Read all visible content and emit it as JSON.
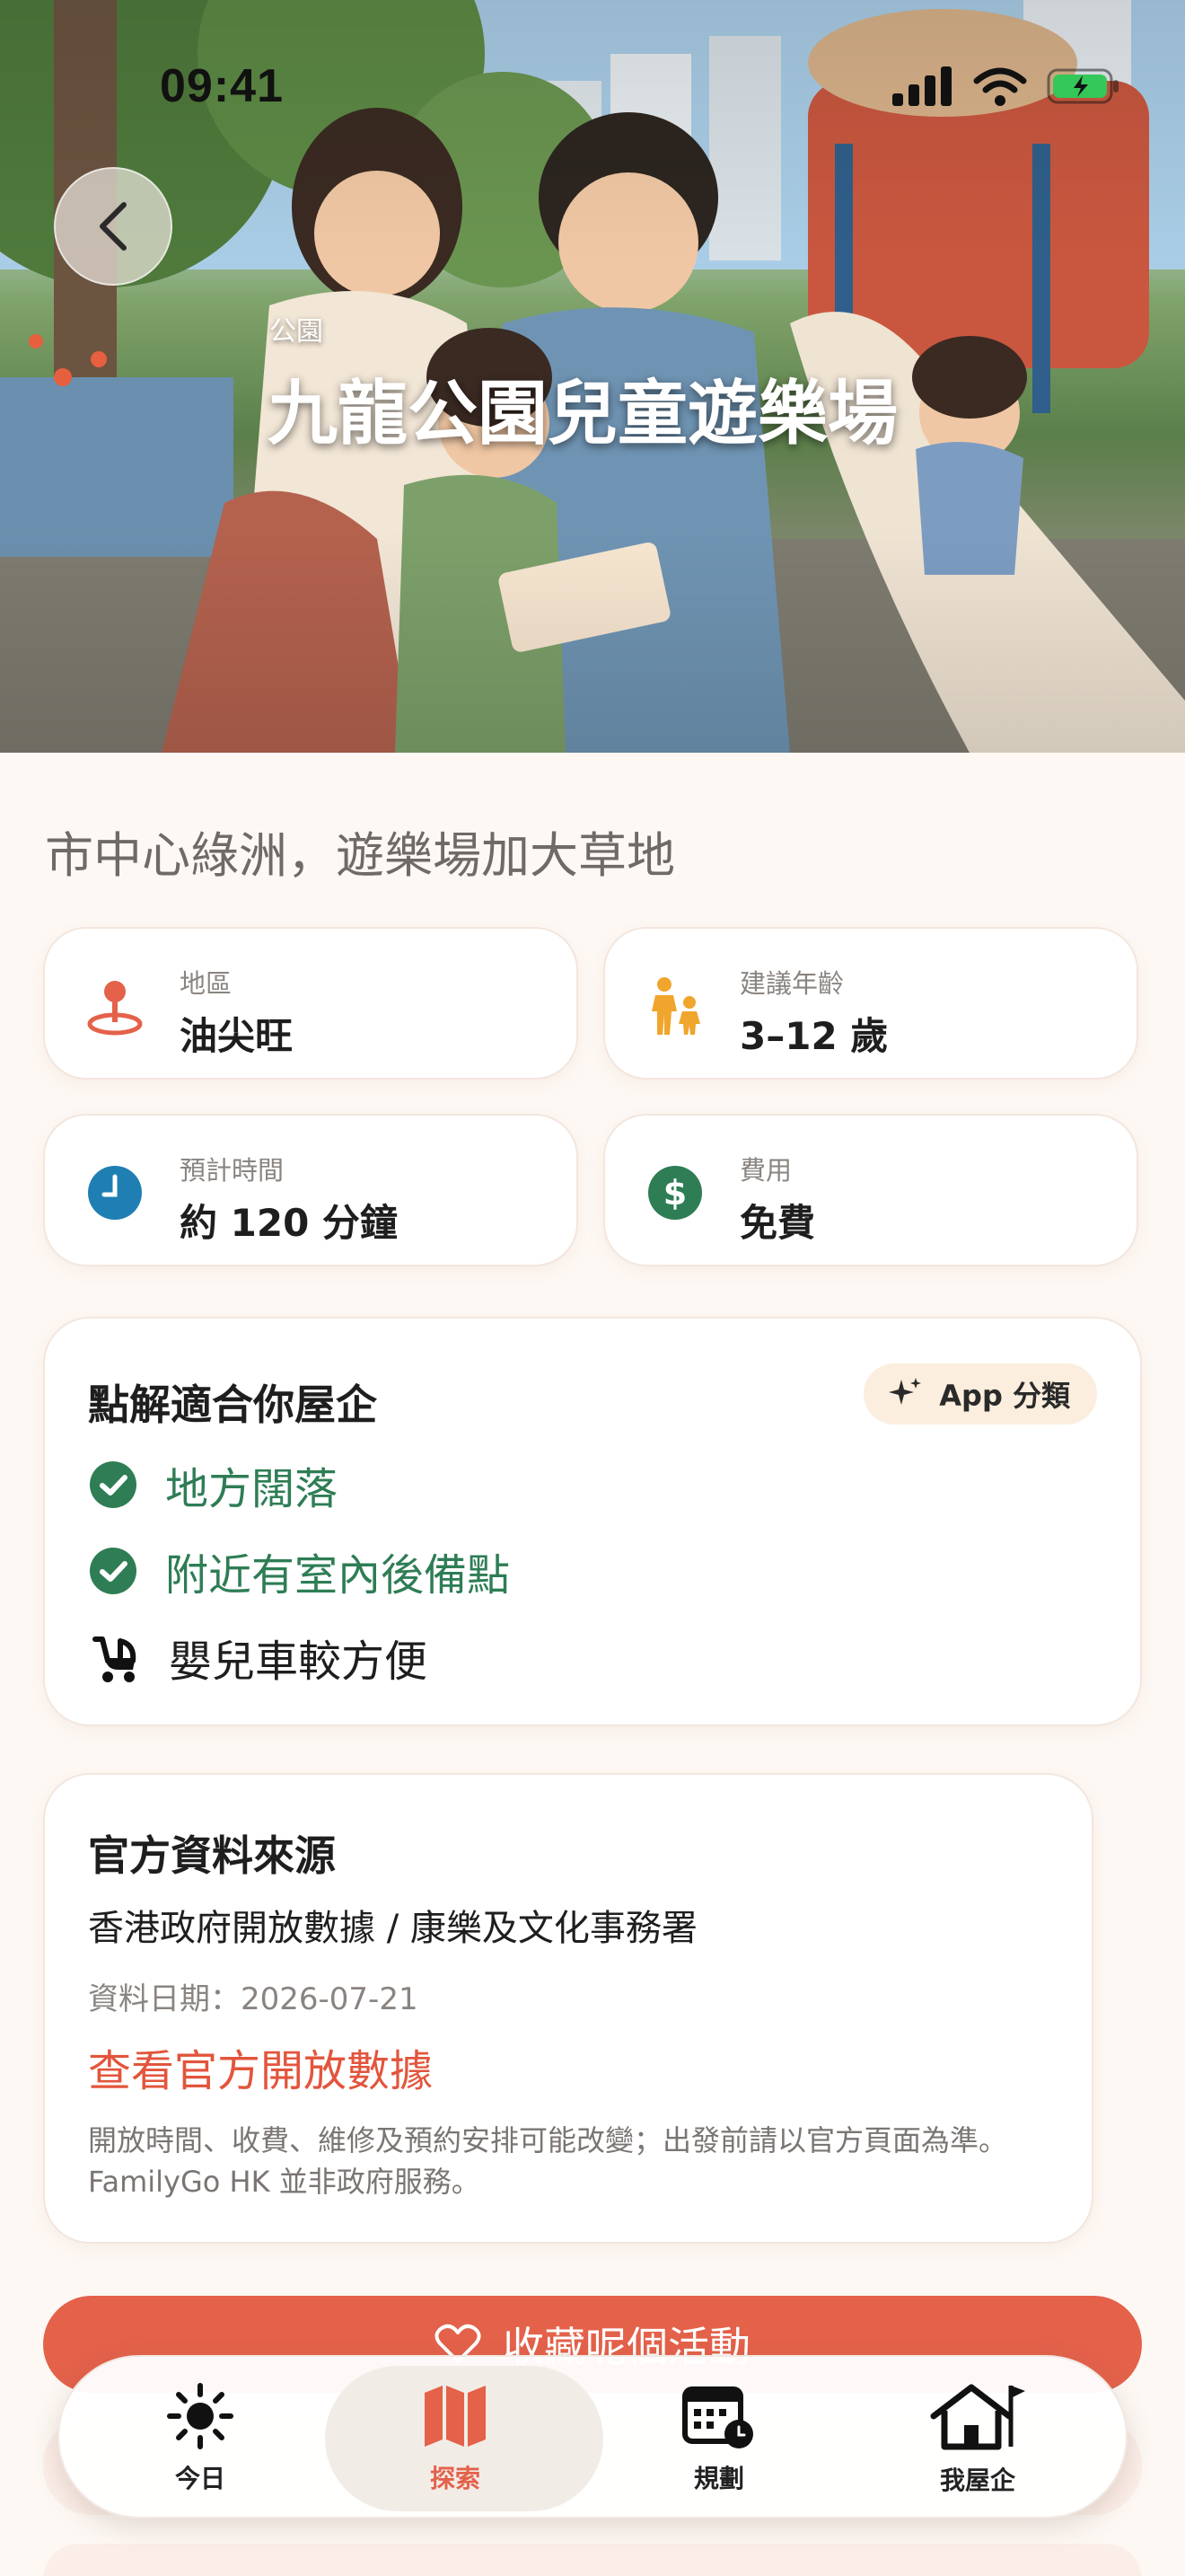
{
  "status_bar": {
    "time": "09:41"
  },
  "hero": {
    "category": "公園",
    "title": "九龍公園兒童遊樂場"
  },
  "tagline": "市中心綠洲，遊樂場加大草地",
  "info_cards": [
    {
      "icon": "location-pin-icon",
      "label": "地區",
      "value": "油尖旺"
    },
    {
      "icon": "family-icon",
      "label": "建議年齡",
      "value": "3–12 歲"
    },
    {
      "icon": "clock-icon",
      "label": "預計時間",
      "value": "約 120 分鐘"
    },
    {
      "icon": "dollar-icon",
      "label": "費用",
      "value": "免費"
    }
  ],
  "why": {
    "title": "點解適合你屋企",
    "badge": "App 分類",
    "items": [
      {
        "icon": "check-circle-icon",
        "text": "地方闊落"
      },
      {
        "icon": "check-circle-icon",
        "text": "附近有室內後備點"
      },
      {
        "icon": "stroller-icon",
        "text": "嬰兒車較方便"
      }
    ]
  },
  "source": {
    "title": "官方資料來源",
    "org": "香港政府開放數據 / 康樂及文化事務署",
    "date": "資料日期：2026-07-21",
    "link": "查看官方開放數據",
    "note": "開放時間、收費、維修及預約安排可能改變；出發前請以官方頁面為準。FamilyGo HK 並非政府服務。"
  },
  "save_button": "收藏呢個活動",
  "tabs": [
    {
      "icon": "sun-icon",
      "label": "今日"
    },
    {
      "icon": "map-icon",
      "label": "探索",
      "active": true
    },
    {
      "icon": "calendar-icon",
      "label": "規劃"
    },
    {
      "icon": "home-icon",
      "label": "我屋企"
    }
  ],
  "colors": {
    "accent": "#e4614a",
    "green": "#2e7d55",
    "background": "#fdf8f4"
  }
}
